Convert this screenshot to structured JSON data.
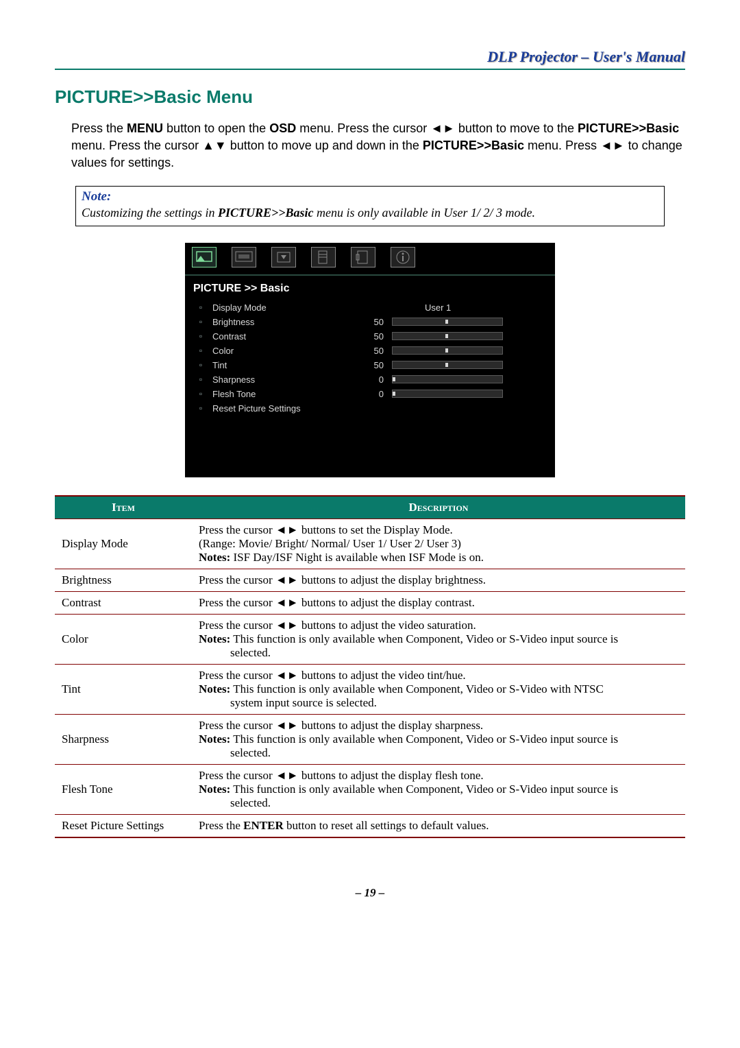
{
  "header": {
    "title": "DLP Projector – User's Manual"
  },
  "section_title": "PICTURE>>Basic Menu",
  "intro": {
    "p1a": "Press the ",
    "menu_b": "MENU",
    "p1b": " button to open the ",
    "osd_b": "OSD",
    "p1c": " menu. Press the cursor ",
    "lr1": "◄►",
    "p1d": " button to move to the ",
    "pb1_b": "PICTURE>>Basic",
    "p1e": " menu. Press the cursor ",
    "ud": "▲▼",
    "p1f": " button to move up and down in the ",
    "pb2_b": "PICTURE>>Basic",
    "p1g": " menu. Press ",
    "lr2": "◄►",
    "p1h": " to change values for settings."
  },
  "note": {
    "title": "Note:",
    "text_a": "Customizing the settings in ",
    "text_bold": "PICTURE>>Basic",
    "text_b": " menu is only available in User 1/ 2/ 3 mode."
  },
  "osd": {
    "title": "PICTURE >> Basic",
    "rows": [
      {
        "icon": "monitor-icon",
        "label": "Display Mode",
        "value_text": "User 1",
        "slider": null
      },
      {
        "icon": "sun-icon",
        "label": "Brightness",
        "value": "50",
        "slider": 50
      },
      {
        "icon": "contrast-icon",
        "label": "Contrast",
        "value": "50",
        "slider": 50
      },
      {
        "icon": "palette-icon",
        "label": "Color",
        "value": "50",
        "slider": 50
      },
      {
        "icon": "tint-icon",
        "label": "Tint",
        "value": "50",
        "slider": 50
      },
      {
        "icon": "sharpness-icon",
        "label": "Sharpness",
        "value": "0",
        "slider": 0
      },
      {
        "icon": "flesh-icon",
        "label": "Flesh Tone",
        "value": "0",
        "slider": 0
      },
      {
        "icon": "reset-icon",
        "label": "Reset Picture Settings",
        "value": "",
        "slider": null
      }
    ]
  },
  "table": {
    "headers": {
      "item": "Item",
      "desc": "Description"
    },
    "rows": [
      {
        "item": "Display Mode",
        "lines": [
          {
            "pre": "Press the cursor ",
            "arr": "◄►",
            "post": " buttons to set the Display Mode."
          },
          {
            "plain": "(Range: Movie/ Bright/ Normal/ User 1/ User 2/ User 3)"
          },
          {
            "bold": "Notes:",
            "post": " ISF Day/ISF Night is available when ISF Mode is on."
          }
        ]
      },
      {
        "item": "Brightness",
        "lines": [
          {
            "pre": "Press the cursor ",
            "arr": "◄►",
            "post": " buttons to adjust the display brightness."
          }
        ]
      },
      {
        "item": "Contrast",
        "lines": [
          {
            "pre": "Press the cursor ",
            "arr": "◄►",
            "post": " buttons to adjust the display contrast."
          }
        ]
      },
      {
        "item": "Color",
        "lines": [
          {
            "pre": "Press the cursor ",
            "arr": "◄►",
            "post": " buttons to adjust the video saturation."
          },
          {
            "bold": "Notes:",
            "post": " This function is only available when Component, Video or S-Video input source is"
          },
          {
            "indent": "selected."
          }
        ]
      },
      {
        "item": "Tint",
        "lines": [
          {
            "pre": "Press the cursor ",
            "arr": "◄►",
            "post": " buttons to adjust the video tint/hue."
          },
          {
            "bold": "Notes:",
            "post": " This function is only available when Component, Video or S-Video with NTSC"
          },
          {
            "indent": "system input source is selected."
          }
        ]
      },
      {
        "item": "Sharpness",
        "lines": [
          {
            "pre": "Press the cursor ",
            "arr": "◄►",
            "post": " buttons to adjust the display sharpness."
          },
          {
            "bold": "Notes:",
            "post": " This function is only available when Component, Video or S-Video input source is"
          },
          {
            "indent": "selected."
          }
        ]
      },
      {
        "item": "Flesh Tone",
        "lines": [
          {
            "pre": "Press the cursor ",
            "arr": "◄►",
            "post": " buttons to adjust the display flesh tone."
          },
          {
            "bold": "Notes:",
            "post": " This function is only available when Component, Video or S-Video input source is"
          },
          {
            "indent": "selected."
          }
        ]
      },
      {
        "item": "Reset Picture Settings",
        "lines": [
          {
            "pre": "Press the ",
            "bold_inline": "ENTER",
            "post": " button to reset all settings to default values."
          }
        ]
      }
    ]
  },
  "footer": {
    "page": "– 19 –"
  }
}
